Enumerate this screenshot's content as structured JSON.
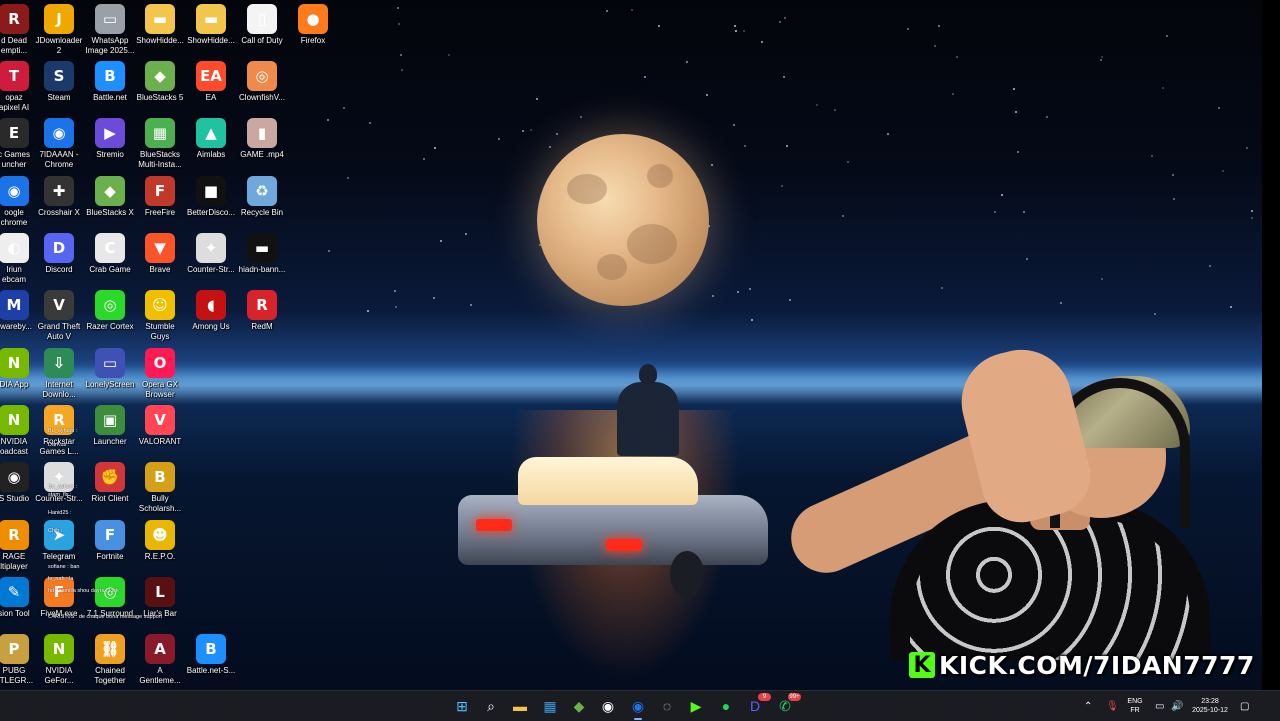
{
  "desktop_icons": [
    {
      "label": "d Dead\nempti...",
      "color": "#8b1a1a",
      "glyph": "R"
    },
    {
      "label": "JDownloader\n2",
      "color": "#f0a800",
      "glyph": "J"
    },
    {
      "label": "WhatsApp\nImage 2025...",
      "color": "#9aa0a8",
      "glyph": "▭"
    },
    {
      "label": "ShowHidde...",
      "color": "#f2c64b",
      "glyph": "▬"
    },
    {
      "label": "ShowHidde...",
      "color": "#f2c64b",
      "glyph": "▬"
    },
    {
      "label": "Call of Duty",
      "color": "#f4f4f4",
      "glyph": "▯"
    },
    {
      "label": "Firefox",
      "color": "#ff7a1a",
      "glyph": "●"
    },
    {
      "label": "opaz\napixel AI",
      "color": "#d01c3c",
      "glyph": "T"
    },
    {
      "label": "Steam",
      "color": "#1b3a6b",
      "glyph": "S"
    },
    {
      "label": "Battle.net",
      "color": "#1d8fff",
      "glyph": "B"
    },
    {
      "label": "BlueStacks 5",
      "color": "#6ab04c",
      "glyph": "◆"
    },
    {
      "label": "EA",
      "color": "#ff4b2b",
      "glyph": "EA"
    },
    {
      "label": "ClownfishV...",
      "color": "#f08a4b",
      "glyph": "◎"
    },
    {
      "label": "c Games\nuncher",
      "color": "#2a2a2a",
      "glyph": "E"
    },
    {
      "label": "7IDAAAN -\nChrome",
      "color": "#1a73e8",
      "glyph": "◉"
    },
    {
      "label": "Stremio",
      "color": "#6c4bd8",
      "glyph": "▶"
    },
    {
      "label": "BlueStacks\nMulti-Insta...",
      "color": "#4caf50",
      "glyph": "▦"
    },
    {
      "label": "Aimlabs",
      "color": "#21c2a0",
      "glyph": "▲"
    },
    {
      "label": "GAME .mp4",
      "color": "#c8a8a0",
      "glyph": "▮"
    },
    {
      "label": "oogle\nchrome",
      "color": "#1a73e8",
      "glyph": "◉"
    },
    {
      "label": "Crosshair X",
      "color": "#333",
      "glyph": "✚"
    },
    {
      "label": "BlueStacks X",
      "color": "#6ab04c",
      "glyph": "◆"
    },
    {
      "label": "FreeFire",
      "color": "#c0392b",
      "glyph": "F"
    },
    {
      "label": "BetterDisco...",
      "color": "#111",
      "glyph": "■"
    },
    {
      "label": "Recycle Bin",
      "color": "#6fa8dc",
      "glyph": "♻"
    },
    {
      "label": "Iriun\nebcam",
      "color": "#eee",
      "glyph": "◐"
    },
    {
      "label": "Discord",
      "color": "#5865f2",
      "glyph": "D"
    },
    {
      "label": "Crab Game",
      "color": "#e8e8e8",
      "glyph": "C"
    },
    {
      "label": "Brave",
      "color": "#fb542b",
      "glyph": "▼"
    },
    {
      "label": "Counter-Str...",
      "color": "#ddd",
      "glyph": "✦"
    },
    {
      "label": "hiadn-bann...",
      "color": "#111",
      "glyph": "▬"
    },
    {
      "label": "swareby...",
      "color": "#1e3fa8",
      "glyph": "M"
    },
    {
      "label": "Grand Theft\nAuto V",
      "color": "#3a3a3a",
      "glyph": "V"
    },
    {
      "label": "Razer Cortex",
      "color": "#2bd92b",
      "glyph": "◎"
    },
    {
      "label": "Stumble\nGuys",
      "color": "#f0c000",
      "glyph": "☺"
    },
    {
      "label": "Among Us",
      "color": "#c51111",
      "glyph": "◖"
    },
    {
      "label": "RedM",
      "color": "#d8232a",
      "glyph": "R"
    },
    {
      "label": "DIA App",
      "color": "#76b900",
      "glyph": "N"
    },
    {
      "label": "Internet\nDownlo...",
      "color": "#2e8b57",
      "glyph": "⇩"
    },
    {
      "label": "LonelyScreen",
      "color": "#3f51b5",
      "glyph": "▭"
    },
    {
      "label": "Opera GX\nBrowser",
      "color": "#ff1a54",
      "glyph": "O"
    },
    {
      "label": "NVIDIA\noadcast",
      "color": "#76b900",
      "glyph": "N"
    },
    {
      "label": "Rockstar\nGames L...",
      "color": "#f5a623",
      "glyph": "R"
    },
    {
      "label": "Launcher",
      "color": "#3c8d3c",
      "glyph": "▣"
    },
    {
      "label": "VALORANT",
      "color": "#ff4655",
      "glyph": "V"
    },
    {
      "label": "S Studio",
      "color": "#222",
      "glyph": "◉"
    },
    {
      "label": "Counter-Str...",
      "color": "#ddd",
      "glyph": "✦"
    },
    {
      "label": "Riot Client",
      "color": "#d13639",
      "glyph": "✊"
    },
    {
      "label": "Bully\nScholarsh...",
      "color": "#d4a017",
      "glyph": "B"
    },
    {
      "label": "RAGE\nltiplayer",
      "color": "#f08c00",
      "glyph": "R"
    },
    {
      "label": "Telegram",
      "color": "#2aa3e0",
      "glyph": "➤"
    },
    {
      "label": "Fortnite",
      "color": "#4a90e2",
      "glyph": "F"
    },
    {
      "label": "R.E.P.O.",
      "color": "#e8b800",
      "glyph": "☻"
    },
    {
      "label": "sion Tool",
      "color": "#0078d4",
      "glyph": "✎"
    },
    {
      "label": "FiveM.exe",
      "color": "#f47920",
      "glyph": "F"
    },
    {
      "label": "7.1 Surround",
      "color": "#2bd92b",
      "glyph": "◎"
    },
    {
      "label": "Liar's Bar",
      "color": "#5a1010",
      "glyph": "L"
    },
    {
      "label": "PUBG\nTTLEGR...",
      "color": "#c8a040",
      "glyph": "P"
    },
    {
      "label": "NVIDIA\nGeFor...",
      "color": "#76b900",
      "glyph": "N"
    },
    {
      "label": "Chained\nTogether",
      "color": "#f0a020",
      "glyph": "⛓"
    },
    {
      "label": "A\nGentleme...",
      "color": "#8a1a2a",
      "glyph": "A"
    },
    {
      "label": "Battle.net-S...",
      "color": "#1d8fff",
      "glyph": "B"
    }
  ],
  "chat_overlay": [
    "Bu_ayham :",
    "DarKus :",
    "Bu_ayham :",
    "stam_flx :",
    "Hanid25 :",
    "Chib :",
    "sofiane : ban",
    "le_nah : la",
    "hd : camilla shou dayra f kick",
    "C4RIST0S : de chaque boha message support"
  ],
  "stream": {
    "kick_logo": "K",
    "url": "KICK.COM/7IDAN7777"
  },
  "taskbar": {
    "apps": [
      {
        "name": "start",
        "glyph": "⊞",
        "color": "#4cc2ff"
      },
      {
        "name": "search",
        "glyph": "⌕",
        "color": "#ffffff"
      },
      {
        "name": "file-explorer",
        "glyph": "▬",
        "color": "#f2c64b"
      },
      {
        "name": "store",
        "glyph": "▦",
        "color": "#3a9bdc"
      },
      {
        "name": "bluestacks",
        "glyph": "◆",
        "color": "#6ab04c"
      },
      {
        "name": "obs",
        "glyph": "◉",
        "color": "#ffffff"
      },
      {
        "name": "chrome",
        "glyph": "◉",
        "color": "#1a73e8",
        "active": true
      },
      {
        "name": "app-badge",
        "glyph": "◌",
        "color": "#dddddd"
      },
      {
        "name": "kick-app",
        "glyph": "▶",
        "color": "#53fc18"
      },
      {
        "name": "spotify",
        "glyph": "●",
        "color": "#1ed760"
      },
      {
        "name": "discord",
        "glyph": "D",
        "color": "#5865f2",
        "badge": "9"
      },
      {
        "name": "whatsapp",
        "glyph": "✆",
        "color": "#25d366",
        "badge": "99+"
      }
    ],
    "tray": {
      "lang_top": "ENG",
      "lang_bottom": "FR",
      "time": "23:28",
      "date": "2025-10-12"
    }
  }
}
